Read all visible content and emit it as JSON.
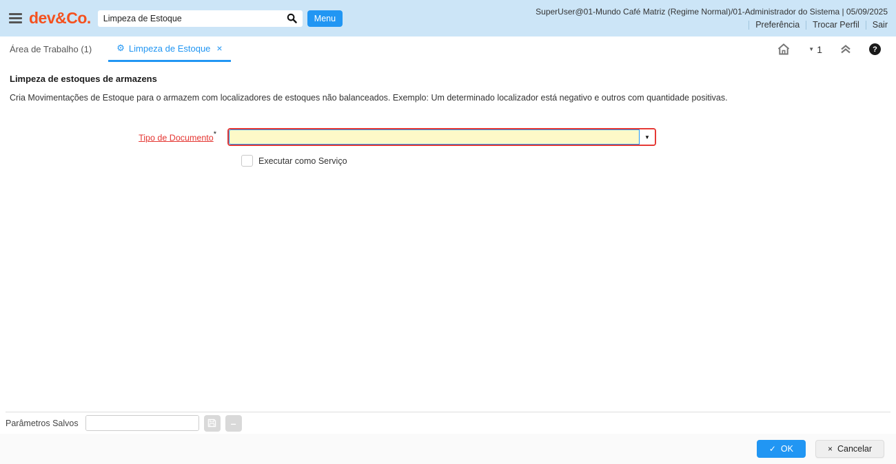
{
  "colors": {
    "header_bg": "#cce5f7",
    "brand_orange": "#f4511e",
    "accent_blue": "#2196f3",
    "mandatory_red": "#e53935",
    "mandatory_field_yellow": "#fdf9c8"
  },
  "header": {
    "logo_text": "dev&Co.",
    "search": {
      "value": "Limpeza de Estoque"
    },
    "menu_button": "Menu",
    "session_info": "SuperUser@01-Mundo Café Matriz (Regime Normal)/01-Administrador do Sistema | 05/09/2025",
    "links": {
      "preferences": "Preferência",
      "change_role": "Trocar Perfil",
      "logout": "Sair"
    }
  },
  "tabbar": {
    "workspace_tab": "Área de Trabalho (1)",
    "active_tab": "Limpeza de Estoque",
    "window_selector_count": "1"
  },
  "process": {
    "title": "Limpeza de estoques de armazens",
    "description": "Cria Movimentações de Estoque para o armazem com localizadores de estoques não balanceados. Exemplo: Um determinado localizador está negativo e outros com quantidade positivas.",
    "document_type": {
      "label": "Tipo de Documento",
      "required_marker": "*",
      "value": ""
    },
    "run_as_service": {
      "label": "Executar como Serviço",
      "checked": false
    }
  },
  "footer": {
    "saved_parameters": {
      "label": "Parâmetros Salvos",
      "value": ""
    },
    "ok_button": "OK",
    "cancel_button": "Cancelar"
  },
  "icons": {
    "gear": "⚙",
    "tab_close": "×",
    "caret_down": "▼",
    "check": "✓",
    "cancel_x": "×",
    "help": "?",
    "minus": "–"
  }
}
